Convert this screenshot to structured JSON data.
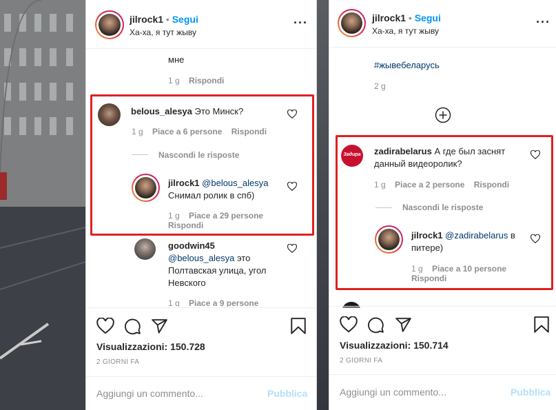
{
  "left_post": {
    "header": {
      "username": "jilrock1",
      "follow": "Segui",
      "dot": "•",
      "location": "Ха-ха, я тут жыву"
    },
    "prev_comment": {
      "text": "мне",
      "time": "1 g",
      "reply": "Rispondi"
    },
    "comment": {
      "username": "belous_alesya",
      "text": "Это Минск?",
      "time": "1 g",
      "likes": "Piace a 6 persone",
      "reply": "Rispondi",
      "hide_replies": "Nascondi le risposte"
    },
    "reply": {
      "username": "jilrock1",
      "mention": "@belous_alesya",
      "text": "Снимал ролик в спб)",
      "time": "1 g",
      "likes": "Piace a 29 persone",
      "reply": "Rispondi"
    },
    "reply2": {
      "username": "goodwin45",
      "mention": "@belous_alesya",
      "text_a": "это",
      "text_b": "Полтавская улица, угол",
      "text_c": "Невского",
      "time": "1 g",
      "likes": "Piace a 9 persone"
    },
    "views": "Visualizzazioni: 150.728",
    "date": "2 GIORNI FA",
    "comment_placeholder": "Aggiungi un commento...",
    "publish": "Pubblica"
  },
  "right_post": {
    "header": {
      "username": "jilrock1",
      "follow": "Segui",
      "dot": "•",
      "location": "Ха-ха, я тут жыву"
    },
    "hashtag": "#жывебеларусь",
    "hashtag_time": "2 g",
    "comment": {
      "username": "zadirabelarus",
      "text_a": "А где был заснят",
      "text_b": "данный видеоролик?",
      "time": "1 g",
      "likes": "Piace a 2 persone",
      "reply": "Rispondi",
      "hide_replies": "Nascondi le risposte",
      "avatar_text": "Задира"
    },
    "reply": {
      "username": "jilrock1",
      "mention": "@zadirabelarus",
      "text_a": "в",
      "text_b": "питере)",
      "time": "1 g",
      "likes": "Piace a 10 persone",
      "reply": "Rispondi"
    },
    "views": "Visualizzazioni: 150.714",
    "date": "2 GIORNI FA",
    "comment_placeholder": "Aggiungi un commento...",
    "publish": "Pubblica"
  },
  "colors": {
    "highlight": "#e02020",
    "link_blue": "#0095f6",
    "mention": "#00376b"
  }
}
